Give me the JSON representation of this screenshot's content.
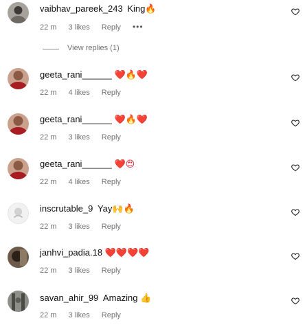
{
  "comments": [
    {
      "username": "vaibhav_pareek_243",
      "text": "King",
      "emoji": "🔥",
      "time": "22 m",
      "likes": "3 likes",
      "reply": "Reply",
      "more": "•••",
      "avatar_color": "#a7a29b",
      "avatar_accent": "#3d3a37"
    },
    {
      "username": "geeta_rani______",
      "text": "",
      "emoji": "❤️🔥❤️",
      "time": "22 m",
      "likes": "4 likes",
      "reply": "Reply",
      "avatar_color": "#b58471",
      "avatar_accent": "#a81d22"
    },
    {
      "username": "geeta_rani______",
      "text": "",
      "emoji": "❤️🔥❤️",
      "time": "22 m",
      "likes": "3 likes",
      "reply": "Reply",
      "avatar_color": "#b58471",
      "avatar_accent": "#a81d22"
    },
    {
      "username": "geeta_rani______",
      "text": "",
      "emoji": "❤️😍",
      "time": "22 m",
      "likes": "4 likes",
      "reply": "Reply",
      "avatar_color": "#b58471",
      "avatar_accent": "#a81d22"
    },
    {
      "username": "inscrutable_9",
      "text": "Yay",
      "emoji": "🙌🔥",
      "time": "22 m",
      "likes": "3 likes",
      "reply": "Reply",
      "avatar_color": "#e7e7e7",
      "avatar_accent": "#c9c9c9"
    },
    {
      "username": "janhvi_padia.18",
      "text": "",
      "emoji": "❤️❤️❤️❤️",
      "time": "22 m",
      "likes": "3 likes",
      "reply": "Reply",
      "avatar_color": "#6d5a4a",
      "avatar_accent": "#2b2119"
    },
    {
      "username": "savan_ahir_99",
      "text": "Amazing",
      "emoji": "👍",
      "time": "22 m",
      "likes": "3 likes",
      "reply": "Reply",
      "avatar_color": "#8f8f8a",
      "avatar_accent": "#4a4a46"
    }
  ],
  "view_replies": "View replies (1)",
  "icons": {
    "like": "heart-outline-icon",
    "more": "more-dots-icon"
  }
}
